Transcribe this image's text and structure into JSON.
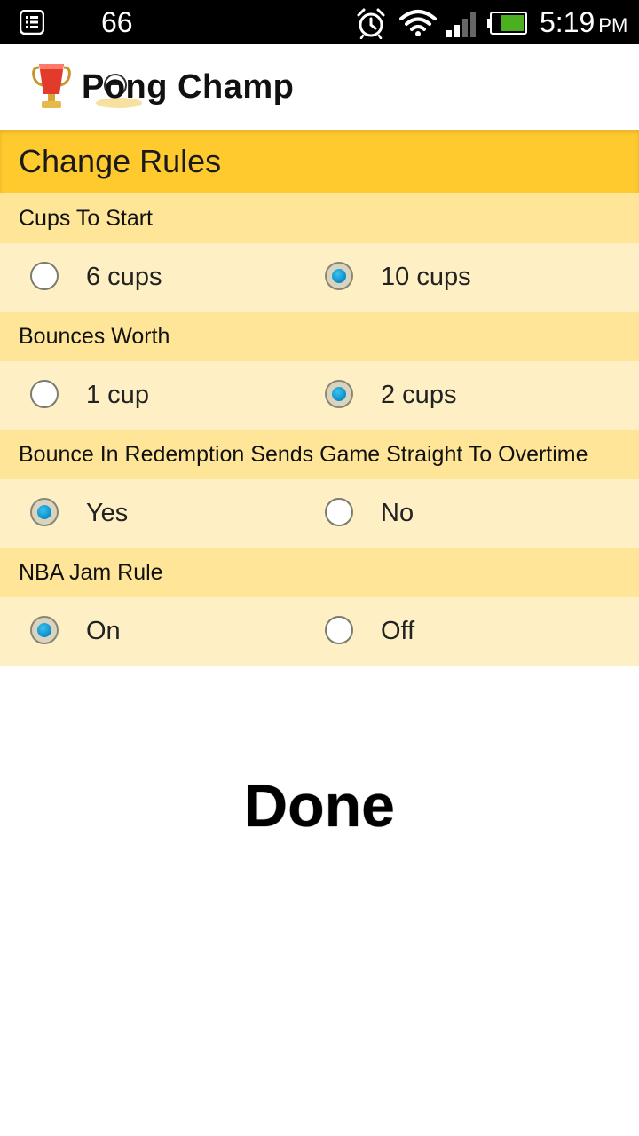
{
  "status_bar": {
    "notification_count": "66",
    "time": "5:19",
    "ampm": "PM",
    "icons": [
      "menu-icon",
      "alarm-icon",
      "wifi-icon",
      "signal-icon",
      "battery-icon"
    ],
    "battery_level": 0.7
  },
  "app": {
    "title": "Pong Champ",
    "logo_icon": "trophy-cup-icon"
  },
  "header": {
    "title": "Change Rules"
  },
  "sections": [
    {
      "title": "Cups To Start",
      "options": [
        {
          "label": "6 cups",
          "checked": false
        },
        {
          "label": "10 cups",
          "checked": true
        }
      ]
    },
    {
      "title": "Bounces Worth",
      "options": [
        {
          "label": "1 cup",
          "checked": false
        },
        {
          "label": "2 cups",
          "checked": true
        }
      ]
    },
    {
      "title": "Bounce In Redemption Sends Game Straight To Overtime",
      "options": [
        {
          "label": "Yes",
          "checked": true
        },
        {
          "label": "No",
          "checked": false
        }
      ]
    },
    {
      "title": "NBA Jam Rule",
      "options": [
        {
          "label": "On",
          "checked": true
        },
        {
          "label": "Off",
          "checked": false
        }
      ]
    }
  ],
  "done_button": {
    "label": "Done"
  },
  "colors": {
    "header": "#ffca2e",
    "section_title": "#ffe597",
    "option_row": "#fef0c4",
    "radio_accent": "#0a8cc6"
  }
}
